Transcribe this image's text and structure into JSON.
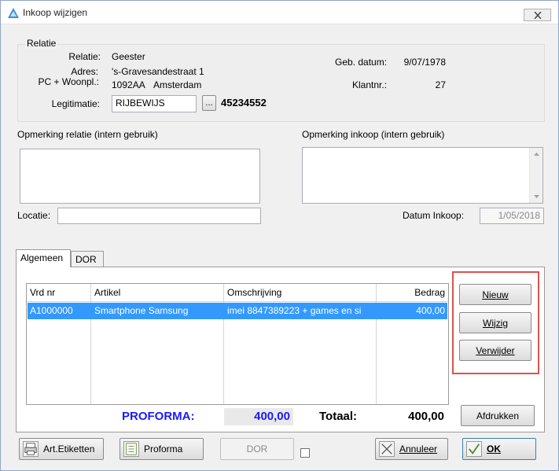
{
  "window": {
    "title": "Inkoop wijzigen"
  },
  "relatie": {
    "legend": "Relatie",
    "relatie_label": "Relatie:",
    "relatie_value": "Geester",
    "adres_label": "Adres:",
    "adres_value": "'s-Gravesandestraat 1",
    "pc_label": "PC + Woonpl.:",
    "postcode": "1092AA",
    "woonplaats": "Amsterdam",
    "legitimatie_label": "Legitimatie:",
    "legitimatie_value": "RIJBEWIJS",
    "browse_label": "...",
    "legitimatie_nr": "45234552",
    "geb_label": "Geb. datum:",
    "geb_value": "9/07/1978",
    "klantnr_label": "Klantnr.:",
    "klantnr_value": "27"
  },
  "opmerking_relatie_label": "Opmerking relatie (intern gebruik)",
  "opmerking_inkoop_label": "Opmerking inkoop (intern gebruik)",
  "locatie_label": "Locatie:",
  "locatie_value": "",
  "datum_inkoop_label": "Datum Inkoop:",
  "datum_inkoop_value": "1/05/2018",
  "tabs": [
    {
      "label": "Algemeen"
    },
    {
      "label": "DOR"
    }
  ],
  "grid": {
    "columns": [
      "Vrd nr",
      "Artikel",
      "Omschrijving",
      "Bedrag"
    ],
    "rows": [
      {
        "vrd_nr": "A1000000",
        "artikel": "Smartphone Samsung",
        "omschrijving": "imei 8847389223  + games en si",
        "bedrag": "400,00"
      }
    ]
  },
  "side_buttons": {
    "nieuw": "Nieuw",
    "wijzig": "Wijzig",
    "verwijder": "Verwijder",
    "afdrukken": "Afdrukken"
  },
  "totals": {
    "proforma_label": "PROFORMA:",
    "proforma_value": "400,00",
    "totaal_label": "Totaal:",
    "totaal_value": "400,00"
  },
  "bottom_buttons": {
    "art_etiketten": "Art.Etiketten",
    "proforma": "Proforma",
    "dor": "DOR",
    "annuleer": "Annuleer",
    "ok": "OK"
  },
  "colors": {
    "selection": "#3399ff",
    "proforma_blue": "#1a1aff",
    "highlight_red": "#d9534f"
  }
}
